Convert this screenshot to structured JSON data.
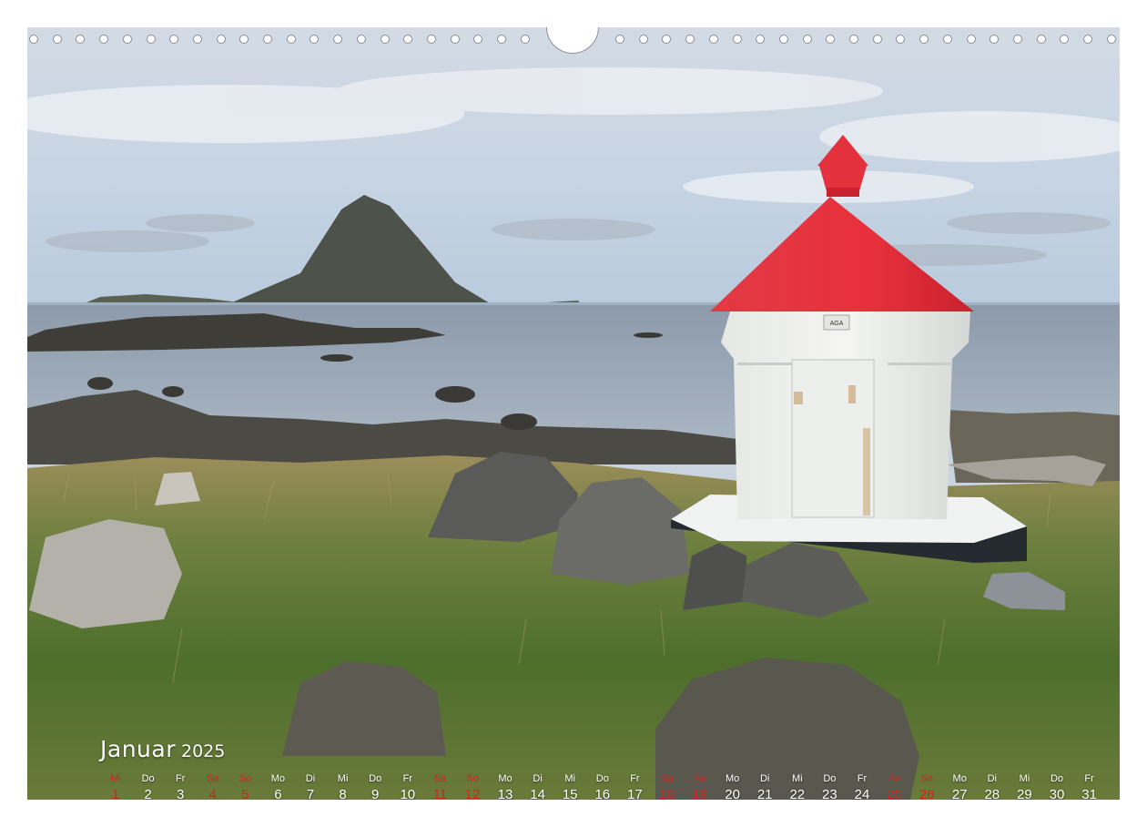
{
  "calendar": {
    "month": "Januar",
    "year": "2025",
    "weekend_color": "#d0251c",
    "text_color": "#ffffff",
    "days": [
      {
        "wd": "Mi",
        "d": "1",
        "weekend": true
      },
      {
        "wd": "Do",
        "d": "2",
        "weekend": false
      },
      {
        "wd": "Fr",
        "d": "3",
        "weekend": false
      },
      {
        "wd": "Sa",
        "d": "4",
        "weekend": true
      },
      {
        "wd": "So",
        "d": "5",
        "weekend": true
      },
      {
        "wd": "Mo",
        "d": "6",
        "weekend": false
      },
      {
        "wd": "Di",
        "d": "7",
        "weekend": false
      },
      {
        "wd": "Mi",
        "d": "8",
        "weekend": false
      },
      {
        "wd": "Do",
        "d": "9",
        "weekend": false
      },
      {
        "wd": "Fr",
        "d": "10",
        "weekend": false
      },
      {
        "wd": "Sa",
        "d": "11",
        "weekend": true
      },
      {
        "wd": "So",
        "d": "12",
        "weekend": true
      },
      {
        "wd": "Mo",
        "d": "13",
        "weekend": false
      },
      {
        "wd": "Di",
        "d": "14",
        "weekend": false
      },
      {
        "wd": "Mi",
        "d": "15",
        "weekend": false
      },
      {
        "wd": "Do",
        "d": "16",
        "weekend": false
      },
      {
        "wd": "Fr",
        "d": "17",
        "weekend": false
      },
      {
        "wd": "Sa",
        "d": "18",
        "weekend": true
      },
      {
        "wd": "So",
        "d": "19",
        "weekend": true
      },
      {
        "wd": "Mo",
        "d": "20",
        "weekend": false
      },
      {
        "wd": "Di",
        "d": "21",
        "weekend": false
      },
      {
        "wd": "Mi",
        "d": "22",
        "weekend": false
      },
      {
        "wd": "Do",
        "d": "23",
        "weekend": false
      },
      {
        "wd": "Fr",
        "d": "24",
        "weekend": false
      },
      {
        "wd": "Sa",
        "d": "25",
        "weekend": true
      },
      {
        "wd": "So",
        "d": "26",
        "weekend": true
      },
      {
        "wd": "Mo",
        "d": "27",
        "weekend": false
      },
      {
        "wd": "Di",
        "d": "28",
        "weekend": false
      },
      {
        "wd": "Mi",
        "d": "29",
        "weekend": false
      },
      {
        "wd": "Do",
        "d": "30",
        "weekend": false
      },
      {
        "wd": "Fr",
        "d": "31",
        "weekend": false
      }
    ]
  },
  "lighthouse": {
    "plate_text": "AGA",
    "roof_color": "#e3323e",
    "body_color": "#eef0ec"
  }
}
